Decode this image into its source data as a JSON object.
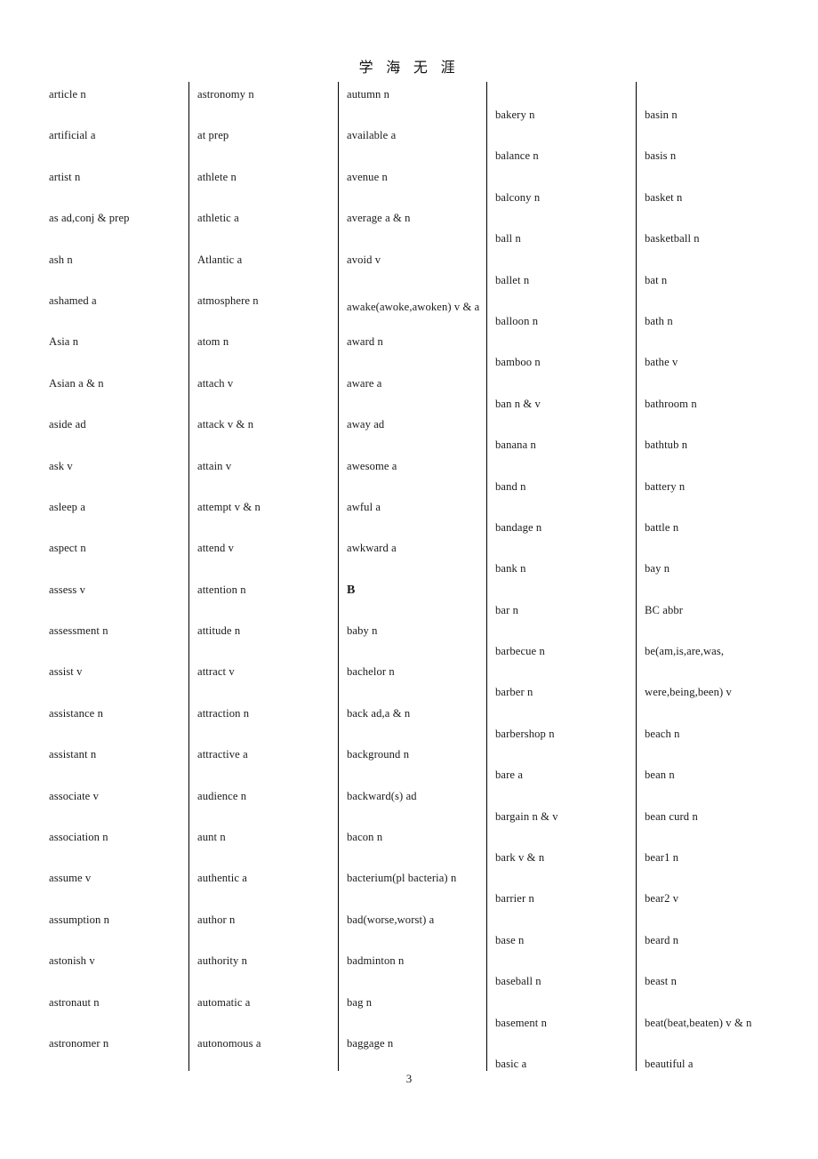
{
  "document": {
    "header_title": "学 海 无 涯",
    "page_number": "3"
  },
  "columns": [
    {
      "id": "column-1",
      "offset_rows": 0,
      "entries": [
        {
          "text": "article n",
          "type": "word"
        },
        {
          "text": "artificial a",
          "type": "word"
        },
        {
          "text": "artist n",
          "type": "word"
        },
        {
          "text": "as ad,conj & prep",
          "type": "word"
        },
        {
          "text": "ash n",
          "type": "word"
        },
        {
          "text": "ashamed a",
          "type": "word"
        },
        {
          "text": "Asia n",
          "type": "word"
        },
        {
          "text": "Asian a & n",
          "type": "word"
        },
        {
          "text": "aside ad",
          "type": "word"
        },
        {
          "text": "ask v",
          "type": "word"
        },
        {
          "text": "asleep a",
          "type": "word"
        },
        {
          "text": "aspect n",
          "type": "word"
        },
        {
          "text": "assess v",
          "type": "word"
        },
        {
          "text": "assessment n",
          "type": "word"
        },
        {
          "text": "assist v",
          "type": "word"
        },
        {
          "text": "assistance n",
          "type": "word"
        },
        {
          "text": "assistant n",
          "type": "word"
        },
        {
          "text": "associate v",
          "type": "word"
        },
        {
          "text": "association n",
          "type": "word"
        },
        {
          "text": "assume v",
          "type": "word"
        },
        {
          "text": "assumption n",
          "type": "word"
        },
        {
          "text": "astonish v",
          "type": "word"
        },
        {
          "text": "astronaut n",
          "type": "word"
        },
        {
          "text": "astronomer n",
          "type": "word"
        }
      ]
    },
    {
      "id": "column-2",
      "offset_rows": 0,
      "entries": [
        {
          "text": "astronomy n",
          "type": "word"
        },
        {
          "text": "at prep",
          "type": "word"
        },
        {
          "text": "athlete n",
          "type": "word"
        },
        {
          "text": "athletic a",
          "type": "word"
        },
        {
          "text": "Atlantic a",
          "type": "word"
        },
        {
          "text": "atmosphere n",
          "type": "word"
        },
        {
          "text": "atom n",
          "type": "word"
        },
        {
          "text": "attach v",
          "type": "word"
        },
        {
          "text": "attack v & n",
          "type": "word"
        },
        {
          "text": "attain v",
          "type": "word"
        },
        {
          "text": "attempt v & n",
          "type": "word"
        },
        {
          "text": "attend v",
          "type": "word"
        },
        {
          "text": "attention n",
          "type": "word"
        },
        {
          "text": "attitude n",
          "type": "word"
        },
        {
          "text": "attract v",
          "type": "word"
        },
        {
          "text": "attraction n",
          "type": "word"
        },
        {
          "text": "attractive a",
          "type": "word"
        },
        {
          "text": "audience n",
          "type": "word"
        },
        {
          "text": "aunt n",
          "type": "word"
        },
        {
          "text": "authentic a",
          "type": "word"
        },
        {
          "text": "author n",
          "type": "word"
        },
        {
          "text": "authority n",
          "type": "word"
        },
        {
          "text": "automatic a",
          "type": "word"
        },
        {
          "text": "autonomous a",
          "type": "word"
        }
      ]
    },
    {
      "id": "column-3",
      "offset_rows": 0,
      "entries": [
        {
          "text": "autumn n",
          "type": "word"
        },
        {
          "text": "available a",
          "type": "word"
        },
        {
          "text": "avenue n",
          "type": "word"
        },
        {
          "text": "average a & n",
          "type": "word"
        },
        {
          "text": "avoid v",
          "type": "word"
        },
        {
          "text": "awake(awoke,awoken) v & a",
          "type": "word-wrapped"
        },
        {
          "text": "award n",
          "type": "word"
        },
        {
          "text": "aware a",
          "type": "word"
        },
        {
          "text": "away ad",
          "type": "word"
        },
        {
          "text": "awesome a",
          "type": "word"
        },
        {
          "text": "awful a",
          "type": "word"
        },
        {
          "text": "awkward a",
          "type": "word"
        },
        {
          "text": "B",
          "type": "section-heading"
        },
        {
          "text": "baby n",
          "type": "word"
        },
        {
          "text": "bachelor n",
          "type": "word"
        },
        {
          "text": "back ad,a & n",
          "type": "word"
        },
        {
          "text": "background n",
          "type": "word"
        },
        {
          "text": "backward(s) ad",
          "type": "word"
        },
        {
          "text": "bacon n",
          "type": "word"
        },
        {
          "text": "bacterium(pl bacteria) n",
          "type": "word"
        },
        {
          "text": "bad(worse,worst) a",
          "type": "word"
        },
        {
          "text": "badminton n",
          "type": "word"
        },
        {
          "text": "bag n",
          "type": "word"
        },
        {
          "text": "baggage n",
          "type": "word"
        }
      ]
    },
    {
      "id": "column-4",
      "offset_rows": 1,
      "entries": [
        {
          "text": "bakery n",
          "type": "word"
        },
        {
          "text": "balance n",
          "type": "word"
        },
        {
          "text": "balcony n",
          "type": "word"
        },
        {
          "text": "ball n",
          "type": "word"
        },
        {
          "text": "ballet n",
          "type": "word"
        },
        {
          "text": "balloon n",
          "type": "word"
        },
        {
          "text": "bamboo n",
          "type": "word"
        },
        {
          "text": "ban n & v",
          "type": "word"
        },
        {
          "text": "banana n",
          "type": "word"
        },
        {
          "text": "band n",
          "type": "word"
        },
        {
          "text": "bandage n",
          "type": "word"
        },
        {
          "text": "bank n",
          "type": "word"
        },
        {
          "text": "bar n",
          "type": "word"
        },
        {
          "text": "barbecue n",
          "type": "word"
        },
        {
          "text": "barber n",
          "type": "word"
        },
        {
          "text": "barbershop n",
          "type": "word"
        },
        {
          "text": "bare a",
          "type": "word"
        },
        {
          "text": "bargain n & v",
          "type": "word"
        },
        {
          "text": "bark v & n",
          "type": "word"
        },
        {
          "text": "barrier n",
          "type": "word"
        },
        {
          "text": "base n",
          "type": "word"
        },
        {
          "text": "baseball n",
          "type": "word"
        },
        {
          "text": "basement n",
          "type": "word"
        },
        {
          "text": "basic a",
          "type": "word"
        }
      ]
    },
    {
      "id": "column-5",
      "offset_rows": 1,
      "entries": [
        {
          "text": "basin n",
          "type": "word"
        },
        {
          "text": "basis n",
          "type": "word"
        },
        {
          "text": "basket n",
          "type": "word"
        },
        {
          "text": "basketball n",
          "type": "word"
        },
        {
          "text": "bat n",
          "type": "word"
        },
        {
          "text": "bath n",
          "type": "word"
        },
        {
          "text": "bathe v",
          "type": "word"
        },
        {
          "text": "bathroom n",
          "type": "word"
        },
        {
          "text": "bathtub n",
          "type": "word"
        },
        {
          "text": "battery n",
          "type": "word"
        },
        {
          "text": "battle n",
          "type": "word"
        },
        {
          "text": "bay n",
          "type": "word"
        },
        {
          "text": "BC abbr",
          "type": "word"
        },
        {
          "text": "be(am,is,are,was,",
          "type": "word"
        },
        {
          "text": "were,being,been) v",
          "type": "word"
        },
        {
          "text": "beach n",
          "type": "word"
        },
        {
          "text": "bean n",
          "type": "word"
        },
        {
          "text": "bean curd n",
          "type": "word"
        },
        {
          "text": "bear1 n",
          "type": "word"
        },
        {
          "text": "bear2 v",
          "type": "word"
        },
        {
          "text": "beard n",
          "type": "word"
        },
        {
          "text": "beast n",
          "type": "word"
        },
        {
          "text": "beat(beat,beaten) v & n",
          "type": "word"
        },
        {
          "text": "beautiful a",
          "type": "word"
        }
      ]
    }
  ]
}
